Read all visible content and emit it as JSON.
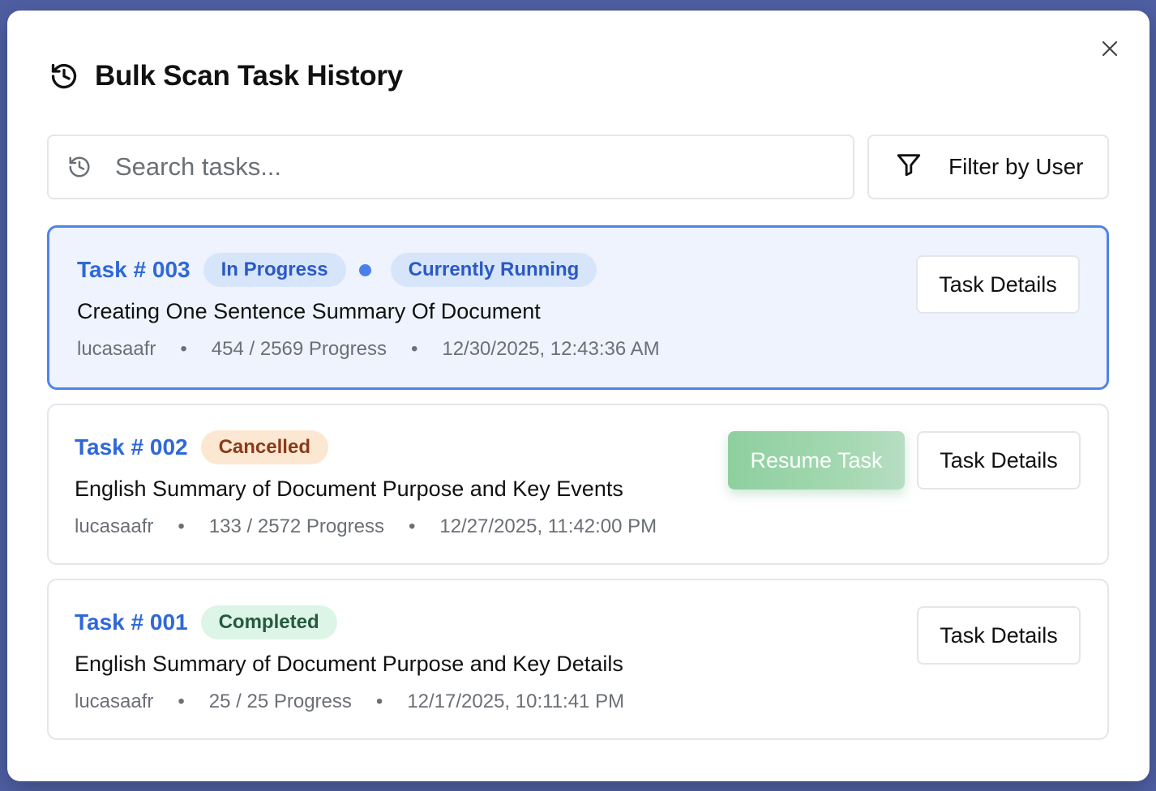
{
  "modal": {
    "title": "Bulk Scan Task History"
  },
  "search": {
    "placeholder": "Search tasks..."
  },
  "filter": {
    "label": "Filter by User"
  },
  "tasks": [
    {
      "id": "Task # 003",
      "status": "In Progress",
      "running_label": "Currently Running",
      "name": "Creating One Sentence Summary Of Document",
      "user": "lucasaafr",
      "progress": "454 / 2569 Progress",
      "timestamp": "12/30/2025, 12:43:36 AM",
      "details_label": "Task Details"
    },
    {
      "id": "Task # 002",
      "status": "Cancelled",
      "name": "English Summary of Document Purpose and Key Events",
      "user": "lucasaafr",
      "progress": "133 / 2572 Progress",
      "timestamp": "12/27/2025, 11:42:00 PM",
      "resume_label": "Resume Task",
      "details_label": "Task Details"
    },
    {
      "id": "Task # 001",
      "status": "Completed",
      "name": "English Summary of Document Purpose and Key Details",
      "user": "lucasaafr",
      "progress": "25 / 25 Progress",
      "timestamp": "12/17/2025, 10:11:41 PM",
      "details_label": "Task Details"
    }
  ],
  "meta_separator": "•",
  "colors": {
    "accent_blue": "#2f68d8",
    "active_border": "#4f83e8",
    "resume_green": "#8ecf9f",
    "backdrop": "#4f5fa3"
  },
  "icons": {
    "header": "history-icon",
    "close": "close-icon",
    "search": "history-icon",
    "filter": "filter-icon"
  }
}
